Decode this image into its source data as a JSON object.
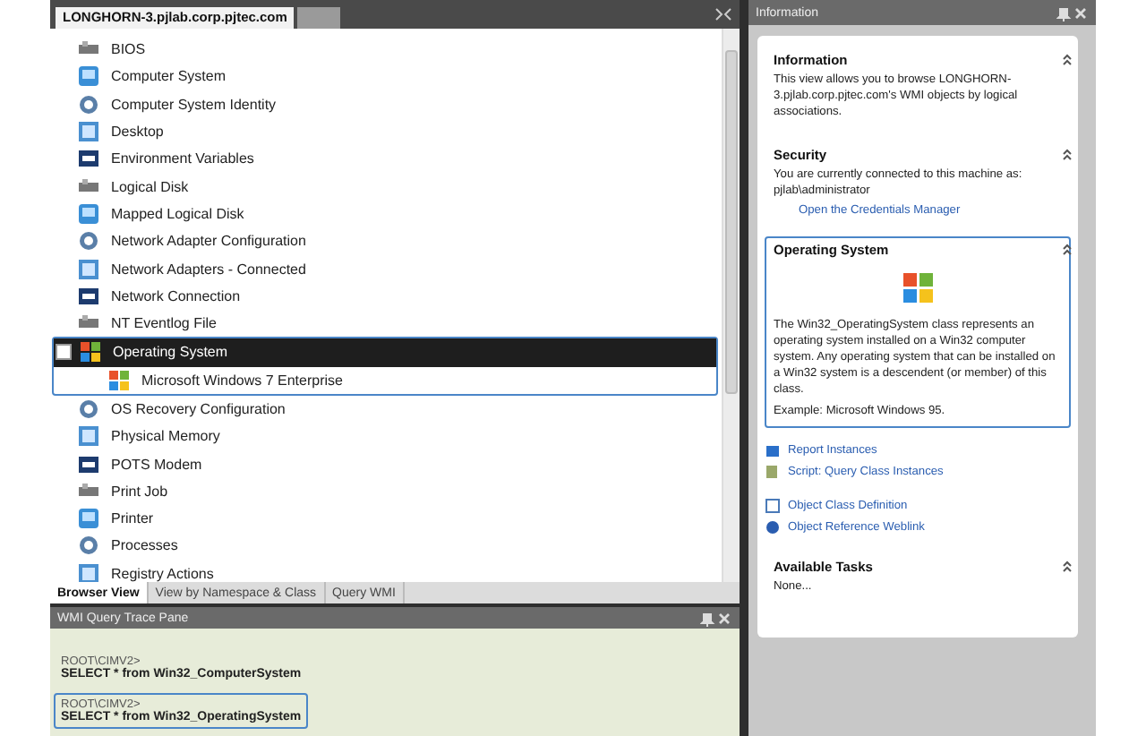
{
  "browser": {
    "tabs": [
      {
        "label": "LONGHORN-3.pjlab.corp.pjtec.com",
        "selected": true
      },
      {
        "selected": false
      }
    ],
    "tree": [
      {
        "label": "BIOS",
        "selected": false
      },
      {
        "label": "Computer System",
        "selected": false
      },
      {
        "label": "Computer System Identity",
        "selected": false
      },
      {
        "label": "Desktop",
        "selected": false
      },
      {
        "label": "Environment Variables",
        "selected": false
      },
      {
        "label": "Logical Disk",
        "selected": false
      },
      {
        "label": "Mapped Logical Disk",
        "selected": false
      },
      {
        "label": "Network Adapter Configuration",
        "selected": false
      },
      {
        "label": "Network Adapters - Connected",
        "selected": false
      },
      {
        "label": "Network Connection",
        "selected": false
      },
      {
        "label": "NT Eventlog File",
        "selected": false
      },
      {
        "label": "Operating System",
        "selected": true,
        "expanded": true,
        "children": [
          {
            "label": "Microsoft Windows 7 Enterprise",
            "selected": false
          }
        ]
      },
      {
        "label": "OS Recovery Configuration",
        "selected": false
      },
      {
        "label": "Physical Memory",
        "selected": false
      },
      {
        "label": "POTS Modem",
        "selected": false
      },
      {
        "label": "Print Job",
        "selected": false
      },
      {
        "label": "Printer",
        "selected": false
      },
      {
        "label": "Processes",
        "selected": false
      },
      {
        "label": "Registry Actions",
        "selected": false
      }
    ],
    "view_tabs": [
      {
        "label": "Browser View",
        "selected": true
      },
      {
        "label": "View by Namespace & Class",
        "selected": false
      },
      {
        "label": "Query WMI",
        "selected": false
      }
    ]
  },
  "trace_pane": {
    "title": "WMI Query Trace Pane",
    "entries": [
      {
        "namespace": "ROOT\\CIMV2>",
        "query": "SELECT * from Win32_ComputerSystem",
        "selected": false
      },
      {
        "namespace": "ROOT\\CIMV2>",
        "query": "SELECT * from Win32_OperatingSystem",
        "selected": true
      }
    ]
  },
  "info_pane": {
    "title": "Information",
    "sections": [
      {
        "kind": "text",
        "title": "Information",
        "text": "This view allows you to browse LONGHORN-3.pjlab.corp.pjtec.com's WMI objects by logical associations."
      },
      {
        "kind": "text",
        "title": "Security",
        "text": "You are currently connected to this machine as: pjlab\\administrator",
        "link": "Open the Credentials Manager"
      },
      {
        "kind": "class",
        "title": "Operating System",
        "selected": true,
        "text": "The Win32_OperatingSystem class represents an operating system installed on a Win32 computer system. Any operating system that can be installed on a Win32 system is a descendent (or member) of this class.",
        "example": "Example: Microsoft Windows 95.",
        "links": [
          [
            "Report Instances",
            "Script: Query Class Instances"
          ],
          [
            "Object Class Definition",
            "Object Reference Weblink"
          ]
        ]
      },
      {
        "kind": "text",
        "title": "Available Tasks",
        "text": "None..."
      }
    ]
  }
}
